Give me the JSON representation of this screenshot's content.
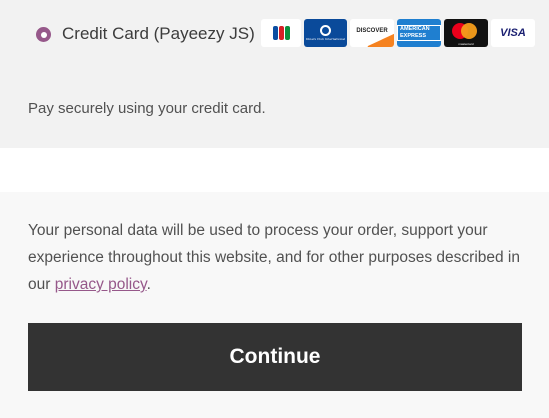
{
  "payment_method": {
    "label": "Credit Card (Payeezy JS)",
    "selected": true,
    "description": "Pay securely using your credit card.",
    "card_icons": [
      {
        "name": "jcb-icon",
        "text": "JCB"
      },
      {
        "name": "diners-club-icon",
        "text": "Diners Club International"
      },
      {
        "name": "discover-icon",
        "text": "DISCOVER"
      },
      {
        "name": "american-express-icon",
        "text": "AMERICAN EXPRESS"
      },
      {
        "name": "mastercard-icon",
        "text": "mastercard"
      },
      {
        "name": "visa-icon",
        "text": "VISA"
      }
    ]
  },
  "privacy": {
    "text_before": "Your personal data will be used to process your order, support your experience throughout this website, and for other purposes described in our ",
    "link_text": "privacy policy",
    "text_after": "."
  },
  "continue_button": {
    "label": "Continue"
  },
  "colors": {
    "accent": "#96588a",
    "button_bg": "#333333",
    "panel_bg": "#f2f2f2"
  }
}
